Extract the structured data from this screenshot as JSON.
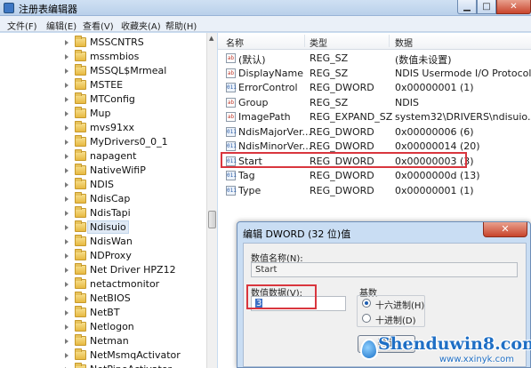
{
  "window": {
    "title": "注册表编辑器",
    "buttons": {
      "min": "▁",
      "max": "□",
      "close": "✕"
    }
  },
  "menu": [
    "文件(F)",
    "编辑(E)",
    "查看(V)",
    "收藏夹(A)",
    "帮助(H)"
  ],
  "tree": {
    "items": [
      {
        "label": "MSSCNTRS"
      },
      {
        "label": "mssmbios"
      },
      {
        "label": "MSSQL$Mrmeal"
      },
      {
        "label": "MSTEE"
      },
      {
        "label": "MTConfig"
      },
      {
        "label": "Mup"
      },
      {
        "label": "mvs91xx"
      },
      {
        "label": "MyDrivers0_0_1"
      },
      {
        "label": "napagent"
      },
      {
        "label": "NativeWifiP"
      },
      {
        "label": "NDIS"
      },
      {
        "label": "NdisCap"
      },
      {
        "label": "NdisTapi"
      },
      {
        "label": "Ndisuio"
      },
      {
        "label": "NdisWan"
      },
      {
        "label": "NDProxy"
      },
      {
        "label": "Net Driver HPZ12"
      },
      {
        "label": "netactmonitor"
      },
      {
        "label": "NetBIOS"
      },
      {
        "label": "NetBT"
      },
      {
        "label": "Netlogon"
      },
      {
        "label": "Netman"
      },
      {
        "label": "NetMsmqActivator"
      },
      {
        "label": "NetPipeActivator"
      }
    ],
    "selected": "Ndisuio"
  },
  "list": {
    "headers": {
      "name": "名称",
      "type": "类型",
      "data": "数据"
    },
    "rows": [
      {
        "icon": "ab",
        "name": "(默认)",
        "type": "REG_SZ",
        "data": "(数值未设置)"
      },
      {
        "icon": "ab",
        "name": "DisplayName",
        "type": "REG_SZ",
        "data": "NDIS Usermode I/O Protocol"
      },
      {
        "icon": "bin",
        "name": "ErrorControl",
        "type": "REG_DWORD",
        "data": "0x00000001 (1)"
      },
      {
        "icon": "ab",
        "name": "Group",
        "type": "REG_SZ",
        "data": "NDIS"
      },
      {
        "icon": "ab",
        "name": "ImagePath",
        "type": "REG_EXPAND_SZ",
        "data": "system32\\DRIVERS\\ndisuio.sys"
      },
      {
        "icon": "bin",
        "name": "NdisMajorVer...",
        "type": "REG_DWORD",
        "data": "0x00000006 (6)"
      },
      {
        "icon": "bin",
        "name": "NdisMinorVer...",
        "type": "REG_DWORD",
        "data": "0x00000014 (20)"
      },
      {
        "icon": "bin",
        "name": "Start",
        "type": "REG_DWORD",
        "data": "0x00000003 (3)"
      },
      {
        "icon": "bin",
        "name": "Tag",
        "type": "REG_DWORD",
        "data": "0x0000000d (13)"
      },
      {
        "icon": "bin",
        "name": "Type",
        "type": "REG_DWORD",
        "data": "0x00000001 (1)"
      }
    ]
  },
  "dialog": {
    "title": "编辑 DWORD (32 位)值",
    "close": "✕",
    "name_label": "数值名称(N):",
    "name_value": "Start",
    "data_label": "数值数据(V):",
    "data_value": "3",
    "base_label": "基数",
    "radix_hex": "十六进制(H)",
    "radix_dec": "十进制(D)",
    "ok": "确定"
  },
  "watermark": {
    "brand": "Shenduwin8.com",
    "sub": "www.xxinyk.com"
  },
  "colors": {
    "highlight": "#d9363e",
    "selection": "#3b6fc5"
  }
}
